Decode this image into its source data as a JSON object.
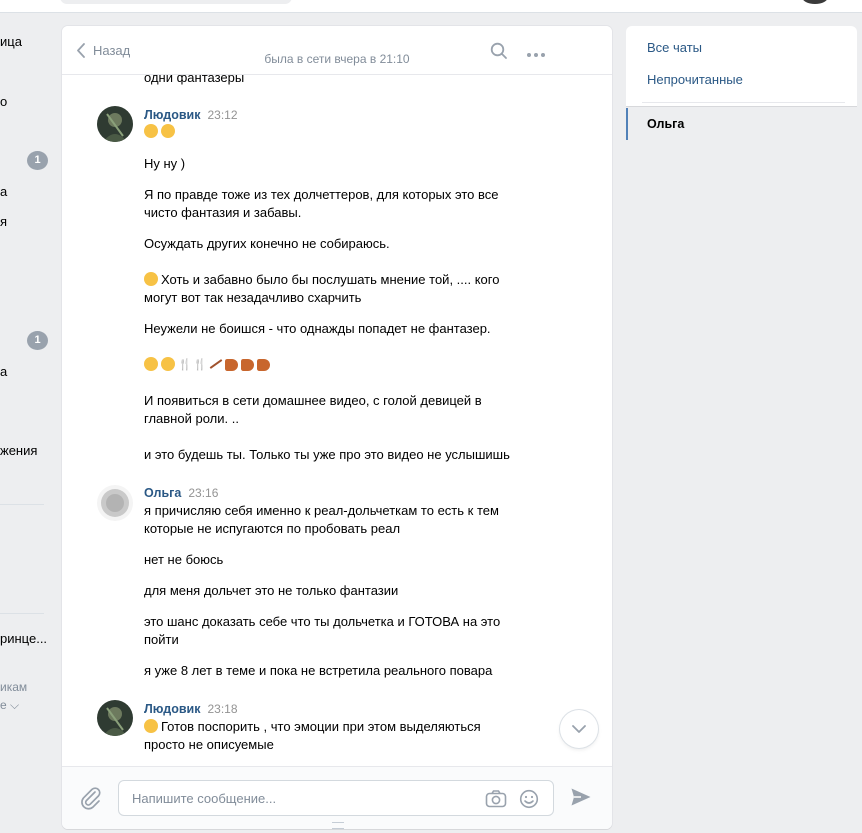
{
  "leftnav": {
    "fragments": [
      "ица",
      "о",
      "а",
      "я",
      "а",
      "жения",
      "ринце...",
      "икам",
      "е ⌵"
    ],
    "badges": [
      "1",
      "1"
    ]
  },
  "header": {
    "back_label": "Назад",
    "status": "была в сети вчера в 21:10",
    "search_icon": "search-icon",
    "more_icon": "more-dots-icon"
  },
  "messages": {
    "top_cut_text": "одни фантазеры",
    "m1": {
      "author": "Людовик",
      "time": "23:12",
      "lines": [
        "Ну ну )",
        "Я по правде тоже из тех долчеттеров, для которых это все чисто фантазия и забавы.",
        "Осуждать других конечно не собираюсь.",
        "Хоть и забавно было бы послушать мнение той, .... кого могут вот так незадачливо схарчить",
        "Неужели не боишся - что однажды попадет не фантазер.",
        "И появиться в сети домашнее видео, с голой девицей в главной роли. ..",
        "и это будешь ты. Только ты уже про это видео не услышишь"
      ]
    },
    "m2": {
      "author": "Ольга",
      "time": "23:16",
      "lines": [
        "я причисляю себя именно к реал-дольчеткам то есть к тем которые не испугаются по пробовать реал",
        "нет не боюсь",
        "для меня дольчет это не только фантазии",
        "это шанс доказать себе что ты дольчетка и ГОТОВА на это пойти",
        "я уже 8 лет в теме и пока не встретила реального повара"
      ]
    },
    "m3": {
      "author": "Людовик",
      "time": "23:18",
      "lines": [
        "Готов поспорить , что эмоции при этом выделяються просто не описуемые"
      ]
    }
  },
  "composer": {
    "placeholder": "Напишите сообщение...",
    "attach_icon": "paperclip-icon",
    "camera_icon": "camera-icon",
    "emoji_icon": "smile-icon",
    "send_icon": "send-icon"
  },
  "right_panel": {
    "all_chats": "Все чаты",
    "unread": "Непрочитанные",
    "active_chat": "Ольга"
  },
  "colors": {
    "page_bg": "#edeef0",
    "link": "#2a5885",
    "muted": "#818c99",
    "badge": "#99a2ad",
    "accent": "#5181b8"
  }
}
